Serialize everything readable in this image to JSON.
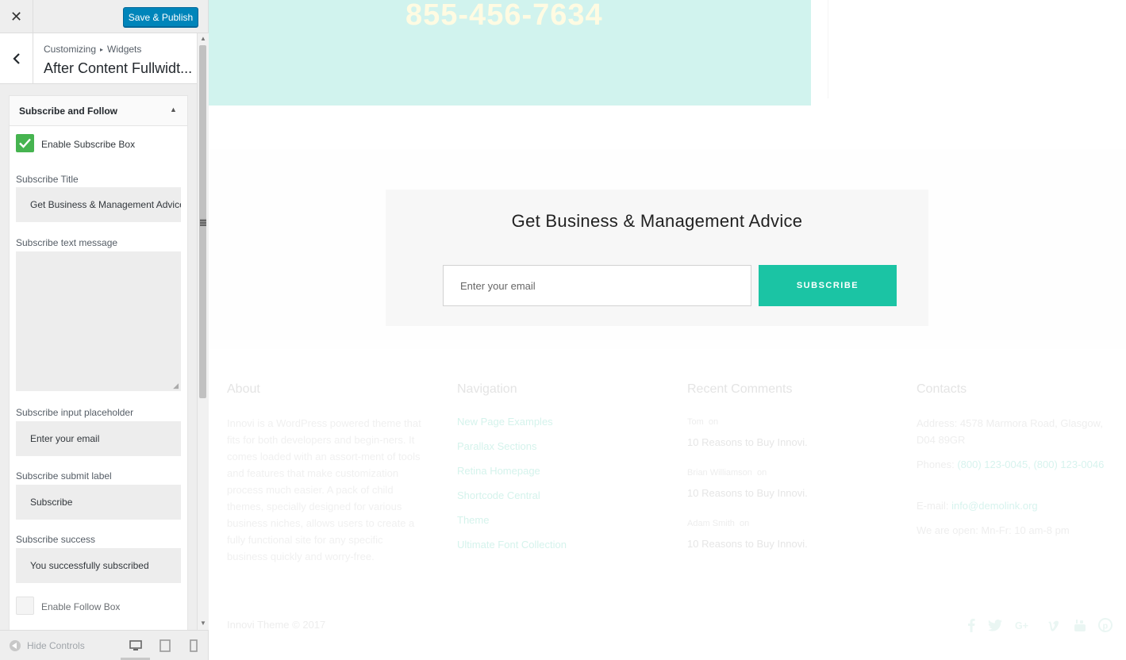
{
  "sidebar": {
    "close_glyph": "✕",
    "save_label": "Save & Publish",
    "breadcrumb_root": "Customizing",
    "breadcrumb_sep": "▸",
    "breadcrumb_section": "Widgets",
    "section_title": "After Content Fullwidt...",
    "widget": {
      "title": "Subscribe and Follow",
      "enable_subscribe_label": "Enable Subscribe Box",
      "enable_subscribe_checked": true,
      "title_label": "Subscribe Title",
      "title_value": "Get Business & Management Advice",
      "text_label": "Subscribe text message",
      "text_value": "",
      "placeholder_label": "Subscribe input placeholder",
      "placeholder_value": "Enter your email",
      "submit_label_label": "Subscribe submit label",
      "submit_label_value": "Subscribe",
      "success_label": "Subscribe success",
      "success_value": "You successfully subscribed",
      "enable_follow_label": "Enable Follow Box",
      "enable_follow_checked": false
    },
    "footer": {
      "hide_controls_label": "Hide Controls",
      "active_device": "desktop"
    }
  },
  "preview": {
    "phone": "855-456-7634",
    "subscribe": {
      "title": "Get Business & Management Advice",
      "placeholder": "Enter your email",
      "button": "SUBSCRIBE"
    },
    "footer": {
      "about": {
        "heading": "About",
        "text": "Innovi is a WordPress powered theme that fits for both developers and begin-ners. It comes loaded with an assort-ment of tools and features that make customization process much easier. A pack of child themes, specially designed for various business niches, allows users to create a fully functional site for any specific business quickly and worry-free."
      },
      "navigation": {
        "heading": "Navigation",
        "links": [
          "New Page Examples",
          "Parallax Sections",
          "Retina Homepage",
          "Shortcode Central",
          "Theme",
          "Ultimate Font Collection"
        ]
      },
      "recent_comments": {
        "heading": "Recent Comments",
        "items": [
          {
            "author": "Tom",
            "on": "on",
            "post": "10 Reasons to Buy Innovi."
          },
          {
            "author": "Brian Williamson",
            "on": "on",
            "post": "10 Reasons to Buy Innovi."
          },
          {
            "author": "Adam Smith",
            "on": "on",
            "post": "10 Reasons to Buy Innovi."
          }
        ]
      },
      "contacts": {
        "heading": "Contacts",
        "address": "Address: 4578 Marmora Road, Glasgow, D04 89GR",
        "phones_label": "Phones:",
        "phones": "(800) 123-0045, (800) 123-0046",
        "email_label": "E-mail:",
        "email": "info@demolink.org",
        "hours": "We are open: Mn-Fr: 10 am-8 pm"
      },
      "copyright": "Innovi Theme © 2017",
      "social_icons": [
        "facebook-icon",
        "twitter-icon",
        "google-plus-icon",
        "vimeo-icon",
        "youtube-icon",
        "pinterest-icon"
      ]
    }
  },
  "colors": {
    "accent": "#1bc4a4",
    "primary_button": "#0085ba",
    "checkbox_checked": "#46b450",
    "phone_band": "#d1f3ee"
  }
}
